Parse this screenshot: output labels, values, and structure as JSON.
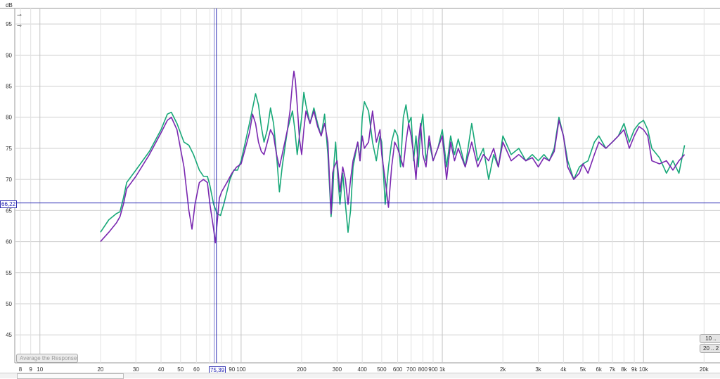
{
  "y_axis_unit": "dB",
  "cursor": {
    "freq_label": "75,39",
    "db_label": "66,22",
    "freq": 75.39,
    "db": 66.22
  },
  "buttons": {
    "average": "Average the Responses",
    "b1": "10 ..",
    "b2": "20 .. 2"
  },
  "tool_icons": [
    "pin-icon",
    "pin-icon"
  ],
  "colors": {
    "green_series": "#18a878",
    "purple_series": "#7a28b0",
    "cursor": "#2b2bb5",
    "grid": "#cfcfcf",
    "grid_minor": "#e2e2e2"
  },
  "chart_data": {
    "type": "line",
    "x_scale": "log",
    "xlim": [
      7.5,
      24000
    ],
    "ylim": [
      40.5,
      97.5
    ],
    "grid": true,
    "y_ticks": [
      45,
      50,
      55,
      60,
      65,
      70,
      75,
      80,
      85,
      90,
      95
    ],
    "x_ticks": [
      {
        "v": 8,
        "t": "8"
      },
      {
        "v": 9,
        "t": "9"
      },
      {
        "v": 10,
        "t": "10"
      },
      {
        "v": 20,
        "t": "20"
      },
      {
        "v": 30,
        "t": "30"
      },
      {
        "v": 40,
        "t": "40"
      },
      {
        "v": 50,
        "t": "50"
      },
      {
        "v": 60,
        "t": "60"
      },
      {
        "v": 90,
        "t": "90"
      },
      {
        "v": 100,
        "t": "100"
      },
      {
        "v": 200,
        "t": "200"
      },
      {
        "v": 300,
        "t": "300"
      },
      {
        "v": 400,
        "t": "400"
      },
      {
        "v": 500,
        "t": "500"
      },
      {
        "v": 600,
        "t": "600"
      },
      {
        "v": 700,
        "t": "700"
      },
      {
        "v": 800,
        "t": "800"
      },
      {
        "v": 900,
        "t": "900"
      },
      {
        "v": 1000,
        "t": "1k"
      },
      {
        "v": 2000,
        "t": "2k"
      },
      {
        "v": 3000,
        "t": "3k"
      },
      {
        "v": 4000,
        "t": "4k"
      },
      {
        "v": 5000,
        "t": "5k"
      },
      {
        "v": 6000,
        "t": "6k"
      },
      {
        "v": 7000,
        "t": "7k"
      },
      {
        "v": 8000,
        "t": "8k"
      },
      {
        "v": 9000,
        "t": "9k"
      },
      {
        "v": 10000,
        "t": "10k"
      },
      {
        "v": 20000,
        "t": "20k"
      }
    ],
    "series": [
      {
        "color": "#18a878",
        "points": [
          [
            20,
            61.5
          ],
          [
            22,
            63.5
          ],
          [
            24,
            64.5
          ],
          [
            25,
            64.8
          ],
          [
            26,
            67
          ],
          [
            27,
            69.5
          ],
          [
            30,
            71.5
          ],
          [
            35,
            74.5
          ],
          [
            40,
            78
          ],
          [
            43,
            80.5
          ],
          [
            45,
            80.8
          ],
          [
            48,
            79
          ],
          [
            52,
            76
          ],
          [
            55,
            75.5
          ],
          [
            58,
            74
          ],
          [
            62,
            71.5
          ],
          [
            65,
            70.5
          ],
          [
            68,
            70.5
          ],
          [
            70,
            69
          ],
          [
            73,
            66
          ],
          [
            76,
            64.5
          ],
          [
            79,
            64.2
          ],
          [
            82,
            66
          ],
          [
            85,
            68
          ],
          [
            88,
            70
          ],
          [
            92,
            71.5
          ],
          [
            96,
            71.5
          ],
          [
            100,
            73
          ],
          [
            105,
            76
          ],
          [
            110,
            79
          ],
          [
            115,
            82
          ],
          [
            118,
            83.8
          ],
          [
            122,
            82
          ],
          [
            126,
            78.5
          ],
          [
            130,
            76
          ],
          [
            135,
            78
          ],
          [
            140,
            81.5
          ],
          [
            145,
            79
          ],
          [
            150,
            74
          ],
          [
            155,
            68
          ],
          [
            160,
            72
          ],
          [
            170,
            78
          ],
          [
            180,
            81
          ],
          [
            185,
            78
          ],
          [
            190,
            74
          ],
          [
            200,
            80
          ],
          [
            205,
            84
          ],
          [
            210,
            82
          ],
          [
            220,
            79
          ],
          [
            230,
            81.5
          ],
          [
            240,
            79
          ],
          [
            250,
            77
          ],
          [
            260,
            80.5
          ],
          [
            270,
            74
          ],
          [
            280,
            64
          ],
          [
            285,
            67
          ],
          [
            290,
            73
          ],
          [
            295,
            76
          ],
          [
            300,
            72
          ],
          [
            310,
            66
          ],
          [
            320,
            71
          ],
          [
            330,
            66
          ],
          [
            340,
            61.5
          ],
          [
            350,
            65
          ],
          [
            360,
            72
          ],
          [
            380,
            76
          ],
          [
            390,
            73
          ],
          [
            400,
            80
          ],
          [
            410,
            82.5
          ],
          [
            430,
            81
          ],
          [
            450,
            76
          ],
          [
            470,
            73
          ],
          [
            490,
            77
          ],
          [
            500,
            76
          ],
          [
            520,
            66
          ],
          [
            540,
            72
          ],
          [
            560,
            76
          ],
          [
            580,
            78
          ],
          [
            600,
            77
          ],
          [
            620,
            72
          ],
          [
            640,
            80
          ],
          [
            660,
            82
          ],
          [
            680,
            79
          ],
          [
            700,
            80
          ],
          [
            720,
            73
          ],
          [
            740,
            77
          ],
          [
            760,
            72
          ],
          [
            780,
            78
          ],
          [
            800,
            80.5
          ],
          [
            830,
            73
          ],
          [
            860,
            76
          ],
          [
            900,
            73
          ],
          [
            950,
            75
          ],
          [
            1000,
            78
          ],
          [
            1050,
            72
          ],
          [
            1100,
            77
          ],
          [
            1150,
            74
          ],
          [
            1200,
            76.5
          ],
          [
            1300,
            72
          ],
          [
            1400,
            79
          ],
          [
            1500,
            73
          ],
          [
            1600,
            75
          ],
          [
            1700,
            70
          ],
          [
            1800,
            74
          ],
          [
            1900,
            72
          ],
          [
            2000,
            77
          ],
          [
            2200,
            74
          ],
          [
            2400,
            75
          ],
          [
            2600,
            73
          ],
          [
            2800,
            74
          ],
          [
            3000,
            73
          ],
          [
            3200,
            74
          ],
          [
            3400,
            73
          ],
          [
            3600,
            75
          ],
          [
            3800,
            80
          ],
          [
            4000,
            77
          ],
          [
            4200,
            73
          ],
          [
            4500,
            70
          ],
          [
            4800,
            72
          ],
          [
            5000,
            72.5
          ],
          [
            5300,
            73
          ],
          [
            5700,
            76
          ],
          [
            6000,
            77
          ],
          [
            6500,
            75
          ],
          [
            7000,
            76
          ],
          [
            7500,
            77
          ],
          [
            8000,
            79
          ],
          [
            8500,
            76
          ],
          [
            9000,
            78
          ],
          [
            9500,
            79
          ],
          [
            10000,
            79.5
          ],
          [
            10500,
            78
          ],
          [
            11000,
            75
          ],
          [
            12000,
            73.5
          ],
          [
            13000,
            71
          ],
          [
            14000,
            73
          ],
          [
            15000,
            71
          ],
          [
            16000,
            75.5
          ]
        ]
      },
      {
        "color": "#7a28b0",
        "points": [
          [
            20,
            60
          ],
          [
            22,
            61.5
          ],
          [
            24,
            63
          ],
          [
            25,
            64
          ],
          [
            26,
            66
          ],
          [
            27,
            68.5
          ],
          [
            30,
            70.5
          ],
          [
            35,
            74
          ],
          [
            40,
            77.5
          ],
          [
            43,
            79.5
          ],
          [
            45,
            80
          ],
          [
            48,
            78
          ],
          [
            52,
            72
          ],
          [
            55,
            65
          ],
          [
            57,
            62
          ],
          [
            59,
            66
          ],
          [
            62,
            69.5
          ],
          [
            65,
            70
          ],
          [
            68,
            69.5
          ],
          [
            70,
            66
          ],
          [
            73,
            62
          ],
          [
            74.5,
            59.8
          ],
          [
            76,
            63
          ],
          [
            78,
            67
          ],
          [
            80,
            68
          ],
          [
            85,
            69.5
          ],
          [
            90,
            71
          ],
          [
            95,
            72
          ],
          [
            100,
            72.5
          ],
          [
            105,
            75
          ],
          [
            110,
            77.5
          ],
          [
            114,
            80.5
          ],
          [
            118,
            79
          ],
          [
            122,
            76
          ],
          [
            126,
            74.5
          ],
          [
            130,
            74
          ],
          [
            135,
            76
          ],
          [
            140,
            78
          ],
          [
            145,
            77
          ],
          [
            150,
            74
          ],
          [
            155,
            72
          ],
          [
            160,
            74
          ],
          [
            170,
            78
          ],
          [
            175,
            81
          ],
          [
            180,
            85.5
          ],
          [
            183,
            87.4
          ],
          [
            186,
            86
          ],
          [
            190,
            82
          ],
          [
            195,
            76.5
          ],
          [
            200,
            74
          ],
          [
            205,
            78
          ],
          [
            210,
            81
          ],
          [
            220,
            79
          ],
          [
            230,
            81
          ],
          [
            240,
            78.5
          ],
          [
            250,
            77
          ],
          [
            260,
            79
          ],
          [
            270,
            76
          ],
          [
            280,
            64.5
          ],
          [
            285,
            71
          ],
          [
            290,
            72
          ],
          [
            300,
            73
          ],
          [
            310,
            68
          ],
          [
            320,
            72
          ],
          [
            330,
            70
          ],
          [
            340,
            66
          ],
          [
            350,
            70
          ],
          [
            360,
            73
          ],
          [
            380,
            76
          ],
          [
            390,
            73
          ],
          [
            400,
            77
          ],
          [
            410,
            75
          ],
          [
            430,
            76
          ],
          [
            450,
            81
          ],
          [
            470,
            76
          ],
          [
            490,
            78
          ],
          [
            500,
            74
          ],
          [
            520,
            70
          ],
          [
            540,
            65.5
          ],
          [
            560,
            72
          ],
          [
            580,
            76
          ],
          [
            600,
            75
          ],
          [
            620,
            73.5
          ],
          [
            640,
            72
          ],
          [
            660,
            76
          ],
          [
            680,
            79
          ],
          [
            700,
            77
          ],
          [
            720,
            74
          ],
          [
            740,
            70
          ],
          [
            760,
            76
          ],
          [
            780,
            79
          ],
          [
            800,
            74
          ],
          [
            830,
            72
          ],
          [
            860,
            77
          ],
          [
            900,
            73
          ],
          [
            950,
            75
          ],
          [
            1000,
            77
          ],
          [
            1050,
            70
          ],
          [
            1100,
            76
          ],
          [
            1150,
            73
          ],
          [
            1200,
            75
          ],
          [
            1300,
            72
          ],
          [
            1400,
            76
          ],
          [
            1500,
            72
          ],
          [
            1600,
            74
          ],
          [
            1700,
            73
          ],
          [
            1800,
            75
          ],
          [
            1900,
            72
          ],
          [
            2000,
            76
          ],
          [
            2200,
            73
          ],
          [
            2400,
            74
          ],
          [
            2600,
            73
          ],
          [
            2800,
            73.5
          ],
          [
            3000,
            72
          ],
          [
            3200,
            73.5
          ],
          [
            3400,
            73
          ],
          [
            3600,
            74.5
          ],
          [
            3800,
            79.5
          ],
          [
            4000,
            77
          ],
          [
            4200,
            72
          ],
          [
            4500,
            70
          ],
          [
            4800,
            71
          ],
          [
            5000,
            72.5
          ],
          [
            5300,
            71
          ],
          [
            5700,
            74
          ],
          [
            6000,
            76
          ],
          [
            6500,
            75
          ],
          [
            7000,
            76
          ],
          [
            7500,
            77
          ],
          [
            8000,
            78
          ],
          [
            8500,
            75
          ],
          [
            9000,
            77
          ],
          [
            9500,
            78.5
          ],
          [
            10000,
            78
          ],
          [
            10500,
            77
          ],
          [
            11000,
            73
          ],
          [
            12000,
            72.5
          ],
          [
            13000,
            73
          ],
          [
            14000,
            71.5
          ],
          [
            15000,
            73
          ],
          [
            16000,
            74
          ]
        ]
      }
    ]
  }
}
